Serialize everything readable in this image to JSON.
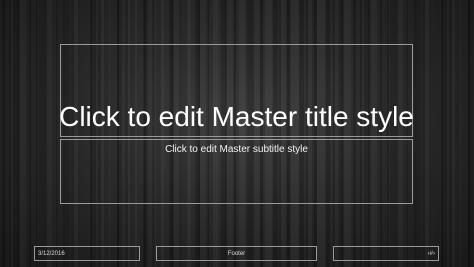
{
  "slide": {
    "title": "Click to edit Master title style",
    "subtitle": "Click to edit Master subtitle style",
    "date": "3/12/2016",
    "footer": "Footer",
    "slide_number": "‹#›"
  }
}
